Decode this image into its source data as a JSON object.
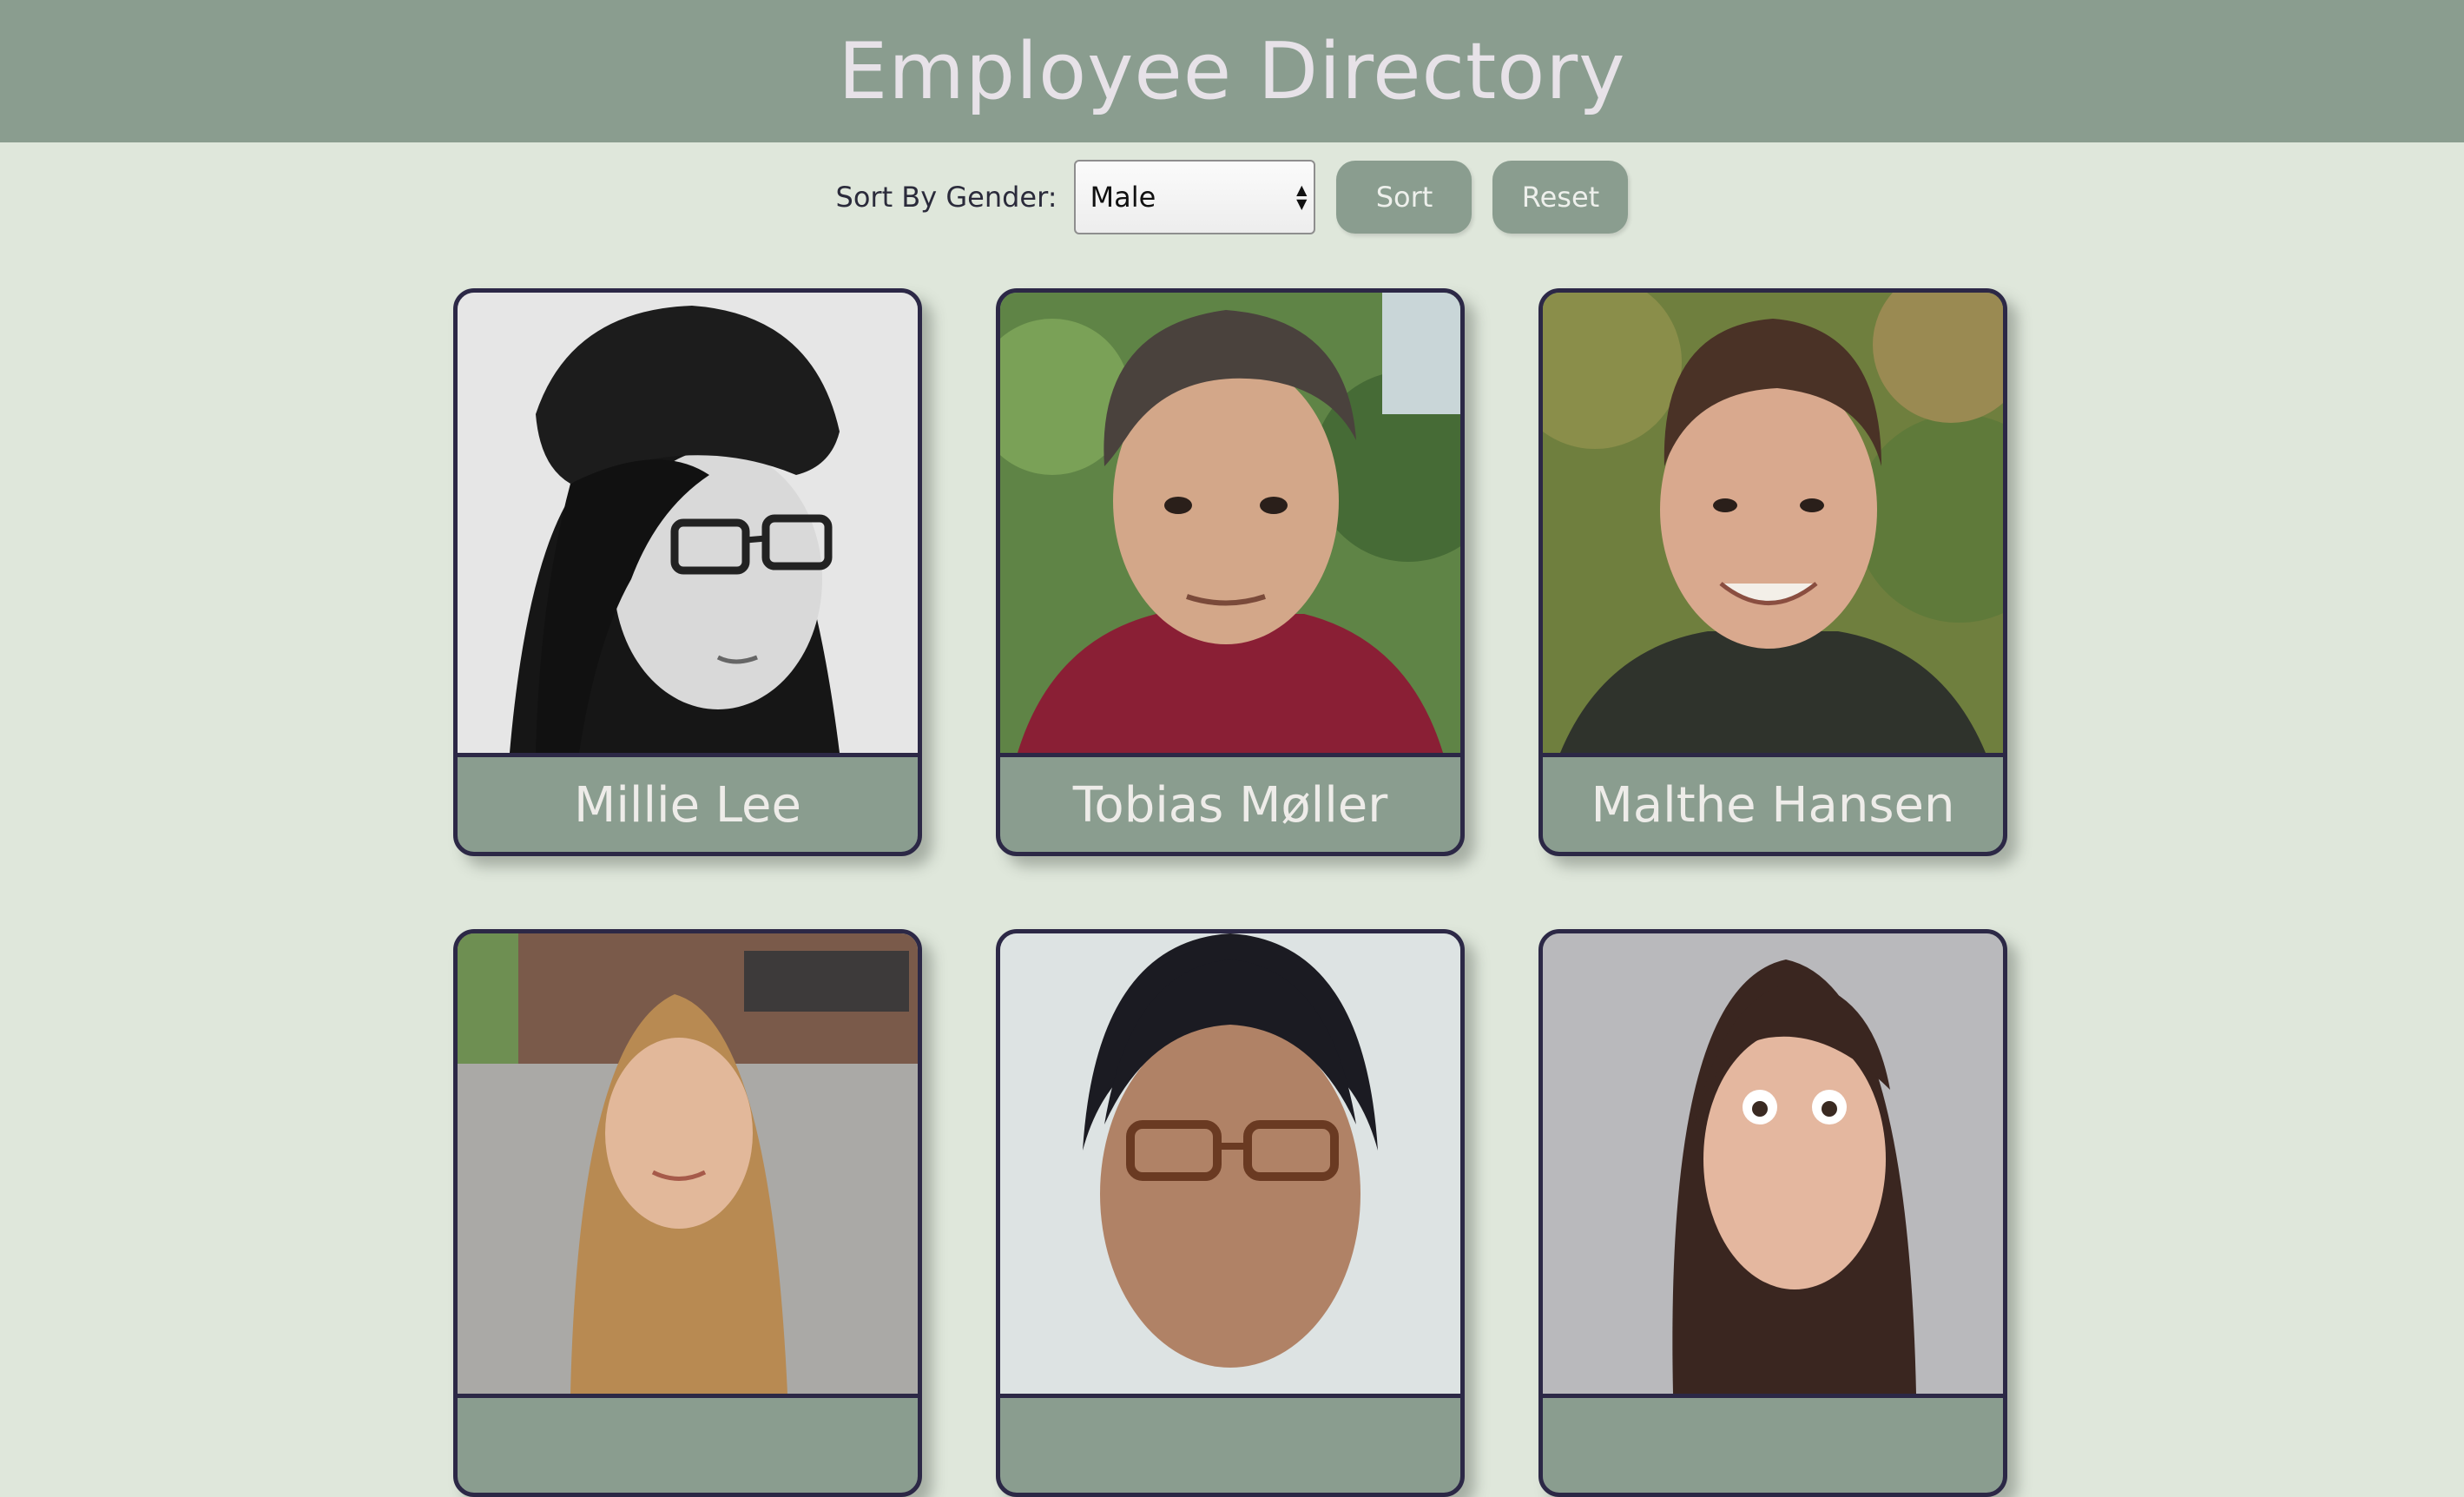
{
  "header": {
    "title": "Employee Directory"
  },
  "controls": {
    "sort_label": "Sort By Gender:",
    "gender_select": {
      "selected": "Male"
    },
    "sort_button": "Sort",
    "reset_button": "Reset"
  },
  "employees": [
    {
      "name": "Millie Lee",
      "photo": "portrait-photo"
    },
    {
      "name": "Tobias Møller",
      "photo": "portrait-photo"
    },
    {
      "name": "Malthe Hansen",
      "photo": "portrait-photo"
    },
    {
      "name": "",
      "photo": "portrait-photo"
    },
    {
      "name": "",
      "photo": "portrait-photo"
    },
    {
      "name": "",
      "photo": "portrait-photo"
    }
  ],
  "colors": {
    "header_bg": "#8a9d8f",
    "page_bg": "#dfe7db",
    "card_border": "#2c2846",
    "title_text": "#e7e2e8"
  }
}
